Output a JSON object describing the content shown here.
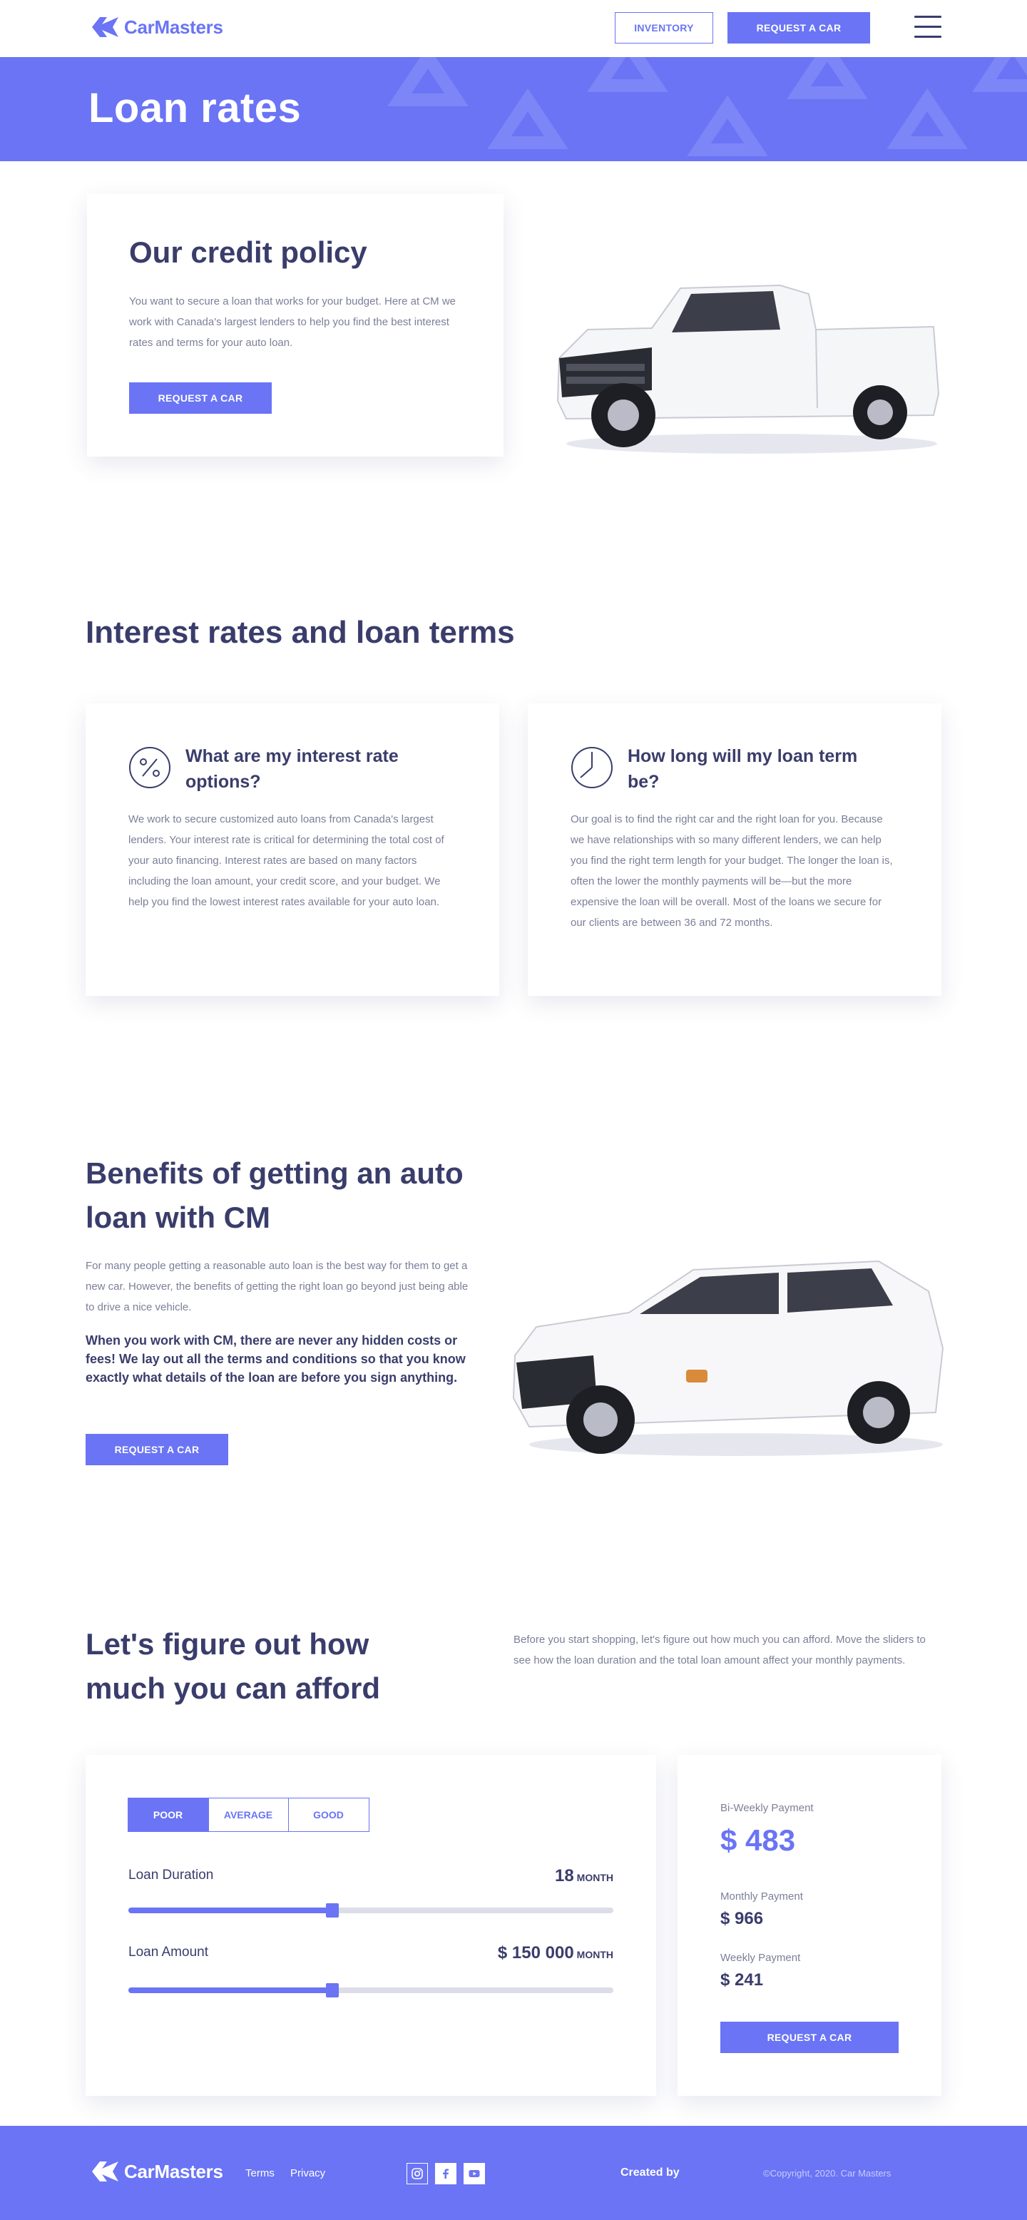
{
  "header": {
    "brand": "CarMasters",
    "inventory_label": "INVENTORY",
    "request_label": "REQUEST A CAR",
    "menu_icon": "hamburger-menu-icon"
  },
  "banner": {
    "title": "Loan rates"
  },
  "credit": {
    "title": "Our credit policy",
    "text": "You want to secure a loan that works for your budget. Here at CM we work with Canada's largest lenders to help you find the best interest rates and terms for your auto loan.",
    "button": "REQUEST A CAR"
  },
  "interest": {
    "title": "Interest rates and loan terms",
    "cards": [
      {
        "icon": "percent-icon",
        "title": "What are my interest rate options?",
        "text": "We work to secure customized auto loans from Canada's largest lenders. Your interest rate is critical for determining the total cost of your auto financing. Interest rates are based on many factors including the loan amount, your credit score, and your budget. We help you find the lowest interest rates available for your auto loan."
      },
      {
        "icon": "clock-icon",
        "title": "How long will my loan term be?",
        "text": "Our goal is to find the right car and the right loan for you. Because we have relationships with so many different lenders, we can help you find the right term length for your budget. The longer the loan is, often the lower the monthly payments will be—but the more expensive the loan will be overall. Most of the loans we secure for our clients are between 36 and 72 months."
      }
    ]
  },
  "benefits": {
    "title": "Benefits of getting an auto loan with CM",
    "text": "For many people getting a reasonable auto loan is the best way for them to get a new car. However, the benefits of getting the right loan go beyond just being able to drive a nice vehicle.",
    "strong": "When you work with CM, there are never any hidden costs or fees! We lay out all the terms and conditions so that you know exactly what details of the loan are before you sign anything.",
    "button": "REQUEST A CAR"
  },
  "afford": {
    "title": "Let's figure out how much you can afford",
    "text": "Before you start shopping, let's figure out how much you can afford. Move the sliders to see how the loan duration and the total loan amount affect your monthly payments."
  },
  "calculator": {
    "credit_options": [
      "POOR",
      "AVERAGE",
      "GOOD"
    ],
    "selected_credit": "POOR",
    "duration": {
      "label": "Loan Duration",
      "value": "18",
      "unit": "MONTH",
      "fraction": 0.42
    },
    "amount": {
      "label": "Loan Amount",
      "value": "$ 150 000",
      "unit": "MONTH",
      "fraction": 0.42
    }
  },
  "payments": {
    "biweekly_label": "Bi-Weekly Payment",
    "biweekly_value": "$ 483",
    "monthly_label": "Monthly Payment",
    "monthly_value": "$ 966",
    "weekly_label": "Weekly Payment",
    "weekly_value": "$ 241",
    "button": "REQUEST A CAR"
  },
  "footer": {
    "brand": "CarMasters",
    "terms": "Terms",
    "privacy": "Privacy",
    "social_icons": [
      "instagram-icon",
      "facebook-icon",
      "youtube-icon"
    ],
    "created_by": "Created by",
    "copyright": "©Copyright, 2020. Car Masters"
  },
  "colors": {
    "accent": "#6a74f5",
    "heading": "#3a3d6b",
    "body": "#7c7f98"
  }
}
